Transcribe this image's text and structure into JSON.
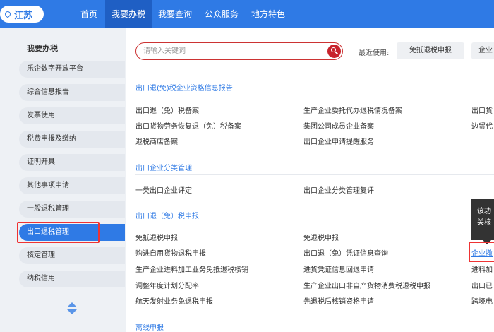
{
  "region": {
    "name": "江苏",
    "icon": "location-pin-icon"
  },
  "nav": [
    "首页",
    "我要办税",
    "我要查询",
    "公众服务",
    "地方特色"
  ],
  "sidebar": {
    "title": "我要办税",
    "items": [
      "乐企数字开放平台",
      "综合信息报告",
      "发票使用",
      "税费申报及缴纳",
      "证明开具",
      "其他事项申请",
      "一般退税管理",
      "出口退税管理",
      "核定管理",
      "纳税信用"
    ]
  },
  "search": {
    "placeholder": "请输入关键词",
    "value": ""
  },
  "recent": {
    "label": "最近使用:",
    "items": [
      "免抵退税申报",
      "企业"
    ]
  },
  "sections": [
    {
      "title": "出口退(免)税企业资格信息报告",
      "rows": [
        [
          "出口退（免）税备案",
          "生产企业委托代办退税情况备案",
          "出口货"
        ],
        [
          "出口货物劳务恢复退（免）税备案",
          "集团公司成员企业备案",
          "边贸代"
        ],
        [
          "退税商店备案",
          "出口企业申请提醒服务",
          ""
        ]
      ]
    },
    {
      "title": "出口企业分类管理",
      "rows": [
        [
          "一类出口企业评定",
          "出口企业分类管理复评",
          ""
        ]
      ]
    },
    {
      "title": "出口退（免）税申报",
      "rows": [
        [
          "免抵退税申报",
          "免退税申报",
          ""
        ],
        [
          "购进自用货物退税申报",
          "出口退（免）凭证信息查询",
          "企业撤"
        ],
        [
          "生产企业进料加工业务免抵退税核销",
          "进货凭证信息回退申请",
          "进料加"
        ],
        [
          "调整年度计划分配率",
          "生产企业出口非自产货物消费税退税申报",
          "出口已"
        ],
        [
          "航天发射业务免退税申报",
          "先退税后核销资格申请",
          "跨境电"
        ]
      ]
    },
    {
      "title": "离线申报",
      "rows": []
    }
  ],
  "tooltip": {
    "line1": "该功",
    "line2": "关核"
  }
}
